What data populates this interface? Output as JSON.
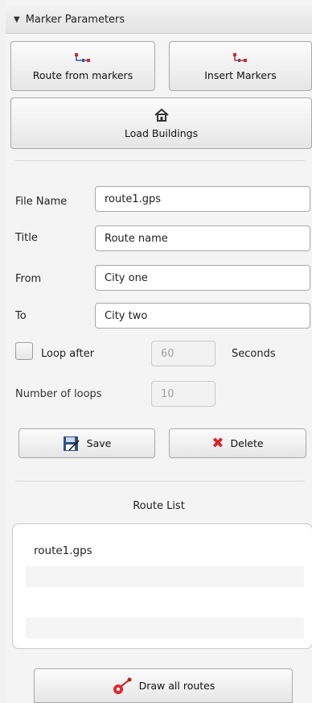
{
  "section": {
    "title": "Marker Parameters",
    "collapse_icon": "triangle-down-icon"
  },
  "buttons": {
    "route_from_markers": {
      "label": "Route from markers",
      "icon": "route-icon"
    },
    "insert_markers": {
      "label": "Insert Markers",
      "icon": "markers-icon"
    },
    "load_buildings": {
      "label": "Load Buildings",
      "icon": "house-icon"
    },
    "save": {
      "label": "Save",
      "icon": "floppy-icon"
    },
    "delete": {
      "label": "Delete",
      "icon": "red-x-icon"
    },
    "draw_all_routes": {
      "label": "Draw all routes",
      "icon": "pin-icon"
    }
  },
  "form": {
    "file_name": {
      "label": "File Name",
      "value": "route1.gps"
    },
    "title": {
      "label": "Title",
      "value": "Route name"
    },
    "from": {
      "label": "From",
      "value": "City one"
    },
    "to": {
      "label": "To",
      "value": "City two"
    },
    "loop_after": {
      "label": "Loop after",
      "value": "60",
      "unit": "Seconds",
      "checked": false
    },
    "number_of_loops": {
      "label": "Number of loops",
      "value": "10"
    }
  },
  "route_list": {
    "title": "Route List",
    "items": [
      "route1.gps"
    ]
  },
  "colors": {
    "accent_red": "#d9242a",
    "icon_blue": "#3a5a9c"
  }
}
